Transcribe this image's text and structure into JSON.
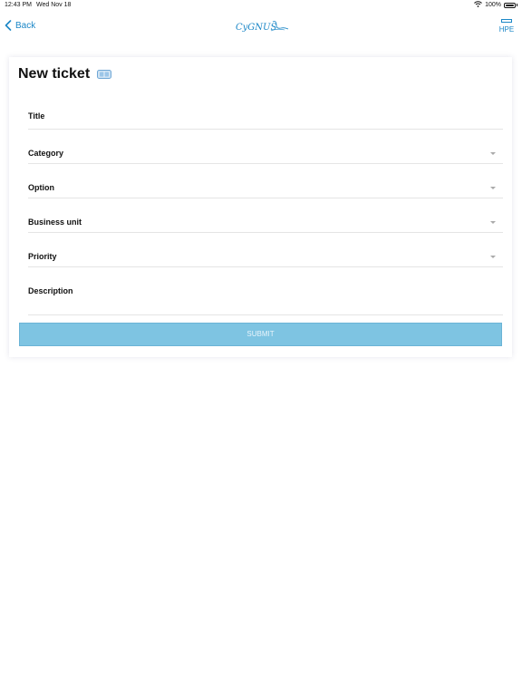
{
  "status_bar": {
    "time": "12:43 PM",
    "date": "Wed Nov 18",
    "battery": "100%",
    "wifi_icon": "wifi-icon",
    "battery_icon": "battery-icon"
  },
  "nav": {
    "back_label": "Back",
    "logo_text": "CyGNUS",
    "hpe_label": "HPE"
  },
  "form": {
    "title": "New ticket",
    "fields": [
      {
        "label": "Title",
        "type": "text"
      },
      {
        "label": "Category",
        "type": "select"
      },
      {
        "label": "Option",
        "type": "select"
      },
      {
        "label": "Business unit",
        "type": "select"
      },
      {
        "label": "Priority",
        "type": "select"
      },
      {
        "label": "Description",
        "type": "textarea"
      }
    ],
    "submit_label": "SUBMIT"
  },
  "colors": {
    "accent": "#1b87c7",
    "submit_bg": "#7ec4e2",
    "divider": "#e5e5e5"
  }
}
